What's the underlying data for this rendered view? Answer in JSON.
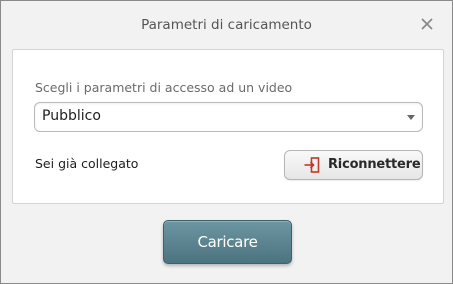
{
  "dialog": {
    "title": "Parametri di caricamento",
    "close_icon": "close-icon"
  },
  "access": {
    "label": "Scegli i parametri di accesso ad un video",
    "selected": "Pubblico"
  },
  "connection": {
    "status": "Sei già collegato",
    "reconnect_label": "Riconnettere",
    "reconnect_icon": "login-icon"
  },
  "footer": {
    "upload_label": "Caricare"
  },
  "colors": {
    "upload_button": "#5a818c",
    "title_text": "#555555"
  }
}
